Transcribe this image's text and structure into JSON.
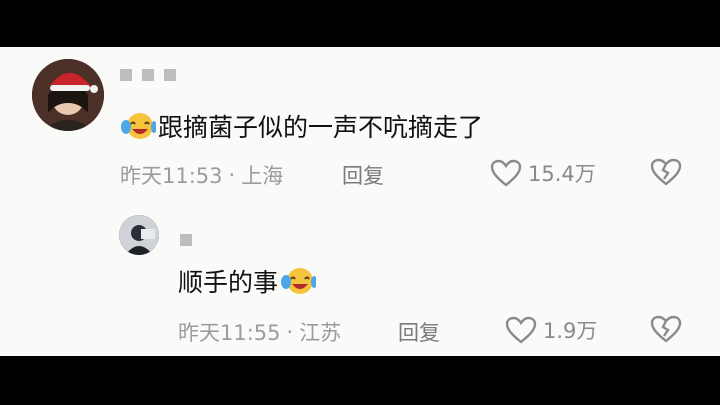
{
  "comments": [
    {
      "text": "跟摘菌子似的一声不吭摘走了",
      "time": "昨天11:53",
      "location": "上海",
      "reply_label": "回复",
      "likes": "15.4万"
    },
    {
      "text": "顺手的事",
      "time": "昨天11:55",
      "location": "江苏",
      "reply_label": "回复",
      "likes": "1.9万"
    }
  ],
  "meta_separator": "·",
  "icons": {
    "like": "heart-outline-icon",
    "dislike": "broken-heart-icon",
    "emoji": "laughing-crying-emoji"
  },
  "colors": {
    "background": "#fafaf8",
    "text": "#111111",
    "meta": "#9c9c9c",
    "frame": "#000000"
  }
}
